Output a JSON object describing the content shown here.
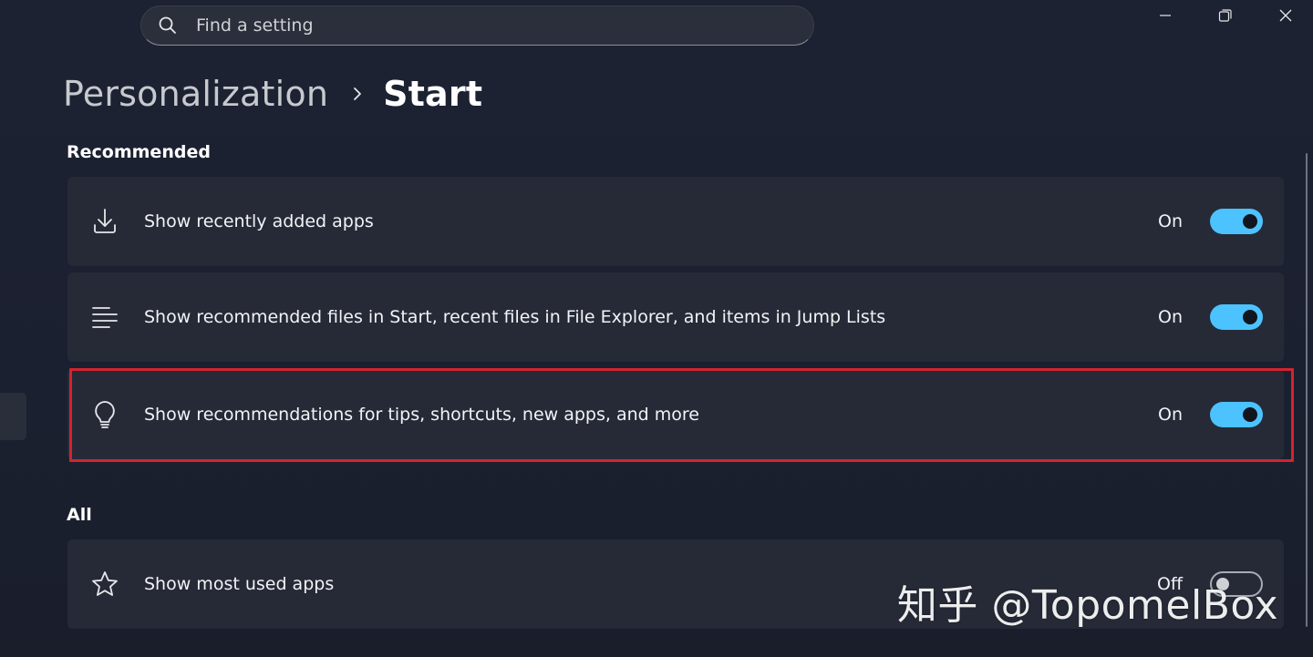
{
  "search": {
    "placeholder": "Find a setting"
  },
  "breadcrumb": {
    "parent": "Personalization",
    "current": "Start"
  },
  "sections": {
    "recommended_title": "Recommended",
    "all_title": "All"
  },
  "settings": [
    {
      "icon": "download-icon",
      "label": "Show recently added apps",
      "state": "On",
      "value": true
    },
    {
      "icon": "list-lines-icon",
      "label": "Show recommended files in Start, recent files in File Explorer, and items in Jump Lists",
      "state": "On",
      "value": true
    },
    {
      "icon": "lightbulb-icon",
      "label": "Show recommendations for tips, shortcuts, new apps, and more",
      "state": "On",
      "value": true,
      "highlighted": true
    },
    {
      "icon": "star-icon",
      "label": "Show most used apps",
      "state": "Off",
      "value": false
    }
  ],
  "watermark": "知乎 @TopomelBox",
  "colors": {
    "accent": "#4cc2ff",
    "highlight": "#d4232f",
    "card": "#262a37",
    "background": "#1d2232"
  }
}
